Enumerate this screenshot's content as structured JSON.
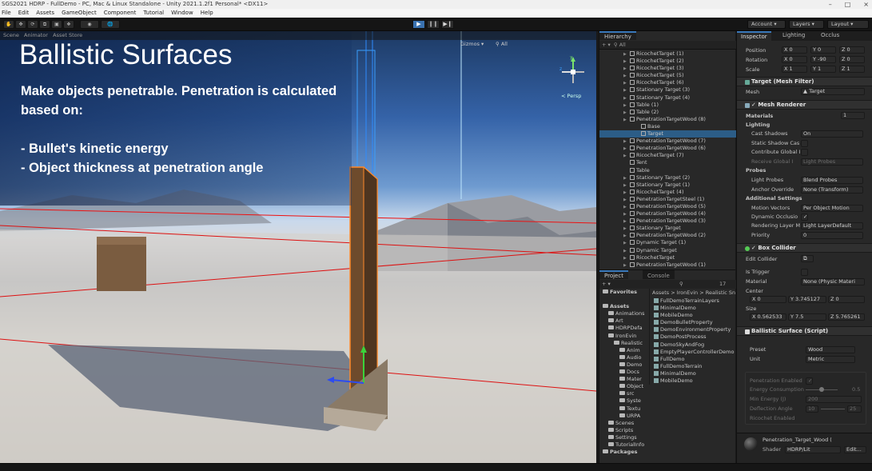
{
  "window": {
    "title": "SGS2021 HDRP - FullDemo - PC, Mac & Linux Standalone - Unity 2021.1.2f1 Personal* <DX11>"
  },
  "menu": [
    "File",
    "Edit",
    "Assets",
    "GameObject",
    "Component",
    "Tutorial",
    "Window",
    "Help"
  ],
  "toolbar": {
    "account": "Account",
    "layers": "Layers",
    "layout": "Layout"
  },
  "scene": {
    "tabs": [
      "Scene",
      "Animator",
      "Asset Store"
    ],
    "gizmos_label": "Gizmos",
    "search_placeholder": "All",
    "persp_label": "< Persp",
    "slide": {
      "title": "Ballistic Surfaces",
      "line1": "Make objects penetrable. Penetration is calculated",
      "line2": "based on:",
      "bullet1": "- Bullet's kinetic energy",
      "bullet2": "- Object thickness at penetration angle"
    }
  },
  "hierarchy": {
    "tab": "Hierarchy",
    "search_placeholder": "All",
    "items": [
      {
        "label": "RicochetTarget (1)",
        "indent": 1,
        "expand": true
      },
      {
        "label": "RicochetTarget (2)",
        "indent": 1,
        "expand": true
      },
      {
        "label": "RicochetTarget (3)",
        "indent": 1,
        "expand": true
      },
      {
        "label": "RicochetTarget (5)",
        "indent": 1,
        "expand": true
      },
      {
        "label": "RicochetTarget (6)",
        "indent": 1,
        "expand": true
      },
      {
        "label": "Stationary Target (3)",
        "indent": 1,
        "expand": true
      },
      {
        "label": "Stationary Target (4)",
        "indent": 1,
        "expand": true
      },
      {
        "label": "Table (1)",
        "indent": 1,
        "expand": true
      },
      {
        "label": "Table (2)",
        "indent": 1,
        "expand": true
      },
      {
        "label": "PenetrationTargetWood (8)",
        "indent": 1,
        "expand": true
      },
      {
        "label": "Base",
        "indent": 2,
        "expand": false
      },
      {
        "label": "Target",
        "indent": 2,
        "expand": false
      },
      {
        "label": "PenetrationTargetWood (7)",
        "indent": 1,
        "expand": true
      },
      {
        "label": "PenetrationTargetWood (6)",
        "indent": 1,
        "expand": true
      },
      {
        "label": "RicochetTarget (7)",
        "indent": 1,
        "expand": true
      },
      {
        "label": "Tent",
        "indent": 1,
        "expand": false
      },
      {
        "label": "Table",
        "indent": 1,
        "expand": false
      },
      {
        "label": "Stationary Target (2)",
        "indent": 1,
        "expand": true
      },
      {
        "label": "Stationary Target (1)",
        "indent": 1,
        "expand": true
      },
      {
        "label": "RicochetTarget (4)",
        "indent": 1,
        "expand": true
      },
      {
        "label": "PenetrationTargetSteel (1)",
        "indent": 1,
        "expand": true
      },
      {
        "label": "PenetrationTargetWood (5)",
        "indent": 1,
        "expand": true
      },
      {
        "label": "PenetrationTargetWood (4)",
        "indent": 1,
        "expand": true
      },
      {
        "label": "PenetrationTargetWood (3)",
        "indent": 1,
        "expand": true
      },
      {
        "label": "Stationary Target",
        "indent": 1,
        "expand": true
      },
      {
        "label": "PenetrationTargetWood (2)",
        "indent": 1,
        "expand": true
      },
      {
        "label": "Dynamic Target (1)",
        "indent": 1,
        "expand": true
      },
      {
        "label": "Dynamic Target",
        "indent": 1,
        "expand": true
      },
      {
        "label": "RicochetTarget",
        "indent": 1,
        "expand": true
      },
      {
        "label": "PenetrationTargetWood (1)",
        "indent": 1,
        "expand": true
      }
    ]
  },
  "project": {
    "tabs": [
      "Project",
      "Console"
    ],
    "count": "17",
    "tree": [
      {
        "label": "Favorites",
        "indent": 0,
        "bold": true
      },
      {
        "label": "",
        "indent": 0,
        "bold": false
      },
      {
        "label": "Assets",
        "indent": 0,
        "bold": true
      },
      {
        "label": "Animations",
        "indent": 1,
        "bold": false
      },
      {
        "label": "Art",
        "indent": 1,
        "bold": false
      },
      {
        "label": "HDRPDefa",
        "indent": 1,
        "bold": false
      },
      {
        "label": "IronEvin",
        "indent": 1,
        "bold": false
      },
      {
        "label": "Realistic",
        "indent": 2,
        "bold": false
      },
      {
        "label": "Anim",
        "indent": 3,
        "bold": false
      },
      {
        "label": "Audio",
        "indent": 3,
        "bold": false
      },
      {
        "label": "Demo",
        "indent": 3,
        "bold": false
      },
      {
        "label": "Docs",
        "indent": 3,
        "bold": false
      },
      {
        "label": "Mater",
        "indent": 3,
        "bold": false
      },
      {
        "label": "Object",
        "indent": 3,
        "bold": false
      },
      {
        "label": "src",
        "indent": 3,
        "bold": false
      },
      {
        "label": "Syste",
        "indent": 3,
        "bold": false
      },
      {
        "label": "Textu",
        "indent": 3,
        "bold": false
      },
      {
        "label": "URPA",
        "indent": 3,
        "bold": false
      },
      {
        "label": "Scenes",
        "indent": 1,
        "bold": false
      },
      {
        "label": "Scripts",
        "indent": 1,
        "bold": false
      },
      {
        "label": "Settings",
        "indent": 1,
        "bold": false
      },
      {
        "label": "TutorialInfo",
        "indent": 1,
        "bold": false
      },
      {
        "label": "Packages",
        "indent": 0,
        "bold": true
      }
    ],
    "breadcrumb": "Assets > IronEvin > Realistic Sn",
    "files": [
      "FullDemoTerrainLayers",
      "MinimalDemo",
      "MobileDemo",
      "DemoBulletProperty",
      "DemoEnvironmentProperty",
      "DemoPostProcess",
      "DemoSkyAndFog",
      "EmptyPlayerControllerDemo",
      "FullDemo",
      "FullDemoTerrain",
      "MinimalDemo",
      "MobileDemo"
    ]
  },
  "inspector": {
    "tabs": [
      "Inspector",
      "Lighting",
      "Occlus"
    ],
    "transform": {
      "position": {
        "label": "Position",
        "x": "0",
        "y": "0",
        "z": "0"
      },
      "rotation": {
        "label": "Rotation",
        "x": "0",
        "y": "-90",
        "z": "0"
      },
      "scale": {
        "label": "Scale",
        "x": "1",
        "y": "1",
        "z": "1"
      }
    },
    "mesh_filter": {
      "title": "Target (Mesh Filter)",
      "mesh_label": "Mesh",
      "mesh_value": "Target"
    },
    "mesh_renderer": {
      "title": "Mesh Renderer",
      "materials_label": "Materials",
      "materials_count": "1",
      "lighting_label": "Lighting",
      "cast_shadows_label": "Cast Shadows",
      "cast_shadows_value": "On",
      "static_shadow_label": "Static Shadow Cas",
      "contribute_gi_label": "Contribute Global I",
      "receive_gi_label": "Receive Global I",
      "receive_gi_value": "Light Probes",
      "probes_label": "Probes",
      "light_probes_label": "Light Probes",
      "light_probes_value": "Blend Probes",
      "anchor_override_label": "Anchor Override",
      "anchor_override_value": "None (Transform)",
      "additional_label": "Additional Settings",
      "motion_vectors_label": "Motion Vectors",
      "motion_vectors_value": "Per Object Motion",
      "dynamic_occlusion_label": "Dynamic Occlusio",
      "rendering_layer_label": "Rendering Layer M",
      "rendering_layer_value": "Light LayerDefault",
      "priority_label": "Priority",
      "priority_value": "0"
    },
    "box_collider": {
      "title": "Box Collider",
      "edit_label": "Edit Collider",
      "is_trigger_label": "Is Trigger",
      "material_label": "Material",
      "material_value": "None (Physic Materi",
      "center_label": "Center",
      "center": {
        "x": "0",
        "y": "3.745127",
        "z": "0"
      },
      "size_label": "Size",
      "size": {
        "x": "0.562533",
        "y": "7.5",
        "z": "5.765261"
      }
    },
    "ballistic_surface": {
      "title": "Ballistic Surface (Script)",
      "preset_label": "Preset",
      "preset_value": "Wood",
      "unit_label": "Unit",
      "unit_value": "Metric",
      "penetration_enabled_label": "Penetration Enabled",
      "energy_consumption_label": "Energy Consumption",
      "energy_consumption_value": "0.5",
      "min_energy_label": "Min Energy (J)",
      "min_energy_value": "200",
      "deflection_label": "Deflection Angle",
      "deflection_min": "10",
      "deflection_max": "25",
      "ricochet_label": "Ricochet Enabled"
    },
    "material": {
      "name": "Penetration_Target_Wood (",
      "shader_label": "Shader",
      "shader_value": "HDRP/Lit",
      "edit_label": "Edit..."
    }
  }
}
